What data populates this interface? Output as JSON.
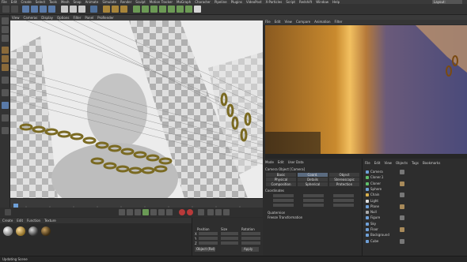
{
  "menu": {
    "items": [
      "File",
      "Edit",
      "Create",
      "Select",
      "Tools",
      "Mesh",
      "Snap",
      "Animate",
      "Simulate",
      "Render",
      "Sculpt",
      "Motion Tracker",
      "MoGraph",
      "Character",
      "Pipeline",
      "Plugins",
      "VideoPost",
      "X-Particles",
      "Script",
      "Redshift",
      "Window",
      "Help"
    ],
    "layout_label": "Layout:"
  },
  "viewport": {
    "menu": [
      "View",
      "Cameras",
      "Display",
      "Options",
      "Filter",
      "Panel",
      "ProRender"
    ]
  },
  "render_view": {
    "menu": [
      "File",
      "Edit",
      "View",
      "Compare",
      "Animation",
      "Filter"
    ]
  },
  "materials": {
    "menu": [
      "Create",
      "Edit",
      "Function",
      "Texture"
    ]
  },
  "coordinates": {
    "headers": [
      "Position",
      "Size",
      "Rotation"
    ],
    "axes": [
      "X",
      "Y",
      "Z"
    ],
    "mode_label": "Object (Rel)",
    "apply_label": "Apply"
  },
  "attributes": {
    "menu": [
      "Mode",
      "Edit",
      "User Data"
    ],
    "object_label": "Camera Object [Camera]",
    "tabs_row1": [
      "Basic",
      "Coord.",
      "Object"
    ],
    "tabs_row2": [
      "Physical",
      "Details",
      "Stereoscopic"
    ],
    "tabs_row3": [
      "Composition",
      "Spherical",
      "Protection"
    ],
    "section": "Coordinates",
    "subsections": [
      "Quaternion",
      "Freeze Transformation"
    ]
  },
  "objects": {
    "menu": [
      "File",
      "Edit",
      "View",
      "Objects",
      "Tags",
      "Bookmarks"
    ],
    "rows": [
      {
        "label": "Camera",
        "color": "#6fa0d8"
      },
      {
        "label": "Cloner.1",
        "color": "#5fbf6a"
      },
      {
        "label": "Cloner",
        "color": "#5fbf6a"
      },
      {
        "label": "Sphere",
        "color": "#6fa0d8"
      },
      {
        "label": "Chain",
        "color": "#d8b04c"
      },
      {
        "label": "Light",
        "color": "#e0e0e0"
      },
      {
        "label": "Plane",
        "color": "#6fa0d8"
      },
      {
        "label": "Null",
        "color": "#aaaaaa"
      },
      {
        "label": "Figure",
        "color": "#6fa0d8"
      },
      {
        "label": "Sky",
        "color": "#6fa0d8"
      },
      {
        "label": "Floor",
        "color": "#6fa0d8"
      },
      {
        "label": "Background",
        "color": "#6fa0d8"
      },
      {
        "label": "Cube",
        "color": "#6fa0d8"
      }
    ]
  },
  "status": {
    "text": "Updating Scene"
  },
  "colors": {
    "ui_bg": "#2b2b2b",
    "accent": "#5b6b80",
    "viewport_bg": "#e8e8e8"
  }
}
